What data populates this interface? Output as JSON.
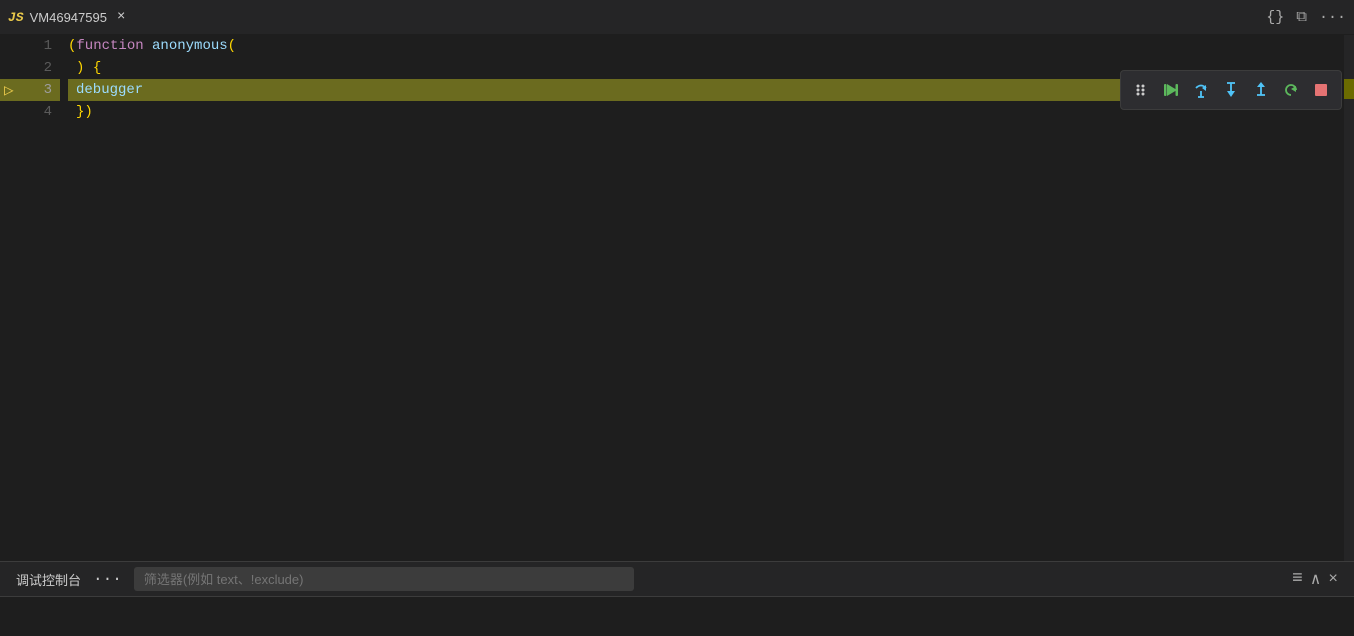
{
  "tab": {
    "js_icon": "JS",
    "title": "VM46947595",
    "close_label": "×"
  },
  "toolbar_right": {
    "format_label": "{}",
    "split_label": "⧉",
    "more_label": "···"
  },
  "debug_toolbar": {
    "dots_label": "⠿",
    "resume_label": "▶",
    "step_over_label": "↺",
    "step_into_label": "↓",
    "step_out_label": "↑",
    "restart_label": "↩",
    "stop_label": "□"
  },
  "code": {
    "lines": [
      {
        "number": "1",
        "content": "(function anonymous(",
        "has_arrow": false
      },
      {
        "number": "2",
        "content": ") {",
        "has_arrow": false
      },
      {
        "number": "3",
        "content": "debugger",
        "has_arrow": true,
        "highlighted": true
      },
      {
        "number": "4",
        "content": "})",
        "has_arrow": false
      }
    ]
  },
  "bottom_panel": {
    "title": "调试控制台",
    "dots_label": "···",
    "filter_placeholder": "筛选器(例如 text、!exclude)",
    "lines_icon": "≡",
    "chevron_up_icon": "∧",
    "close_icon": "×"
  }
}
